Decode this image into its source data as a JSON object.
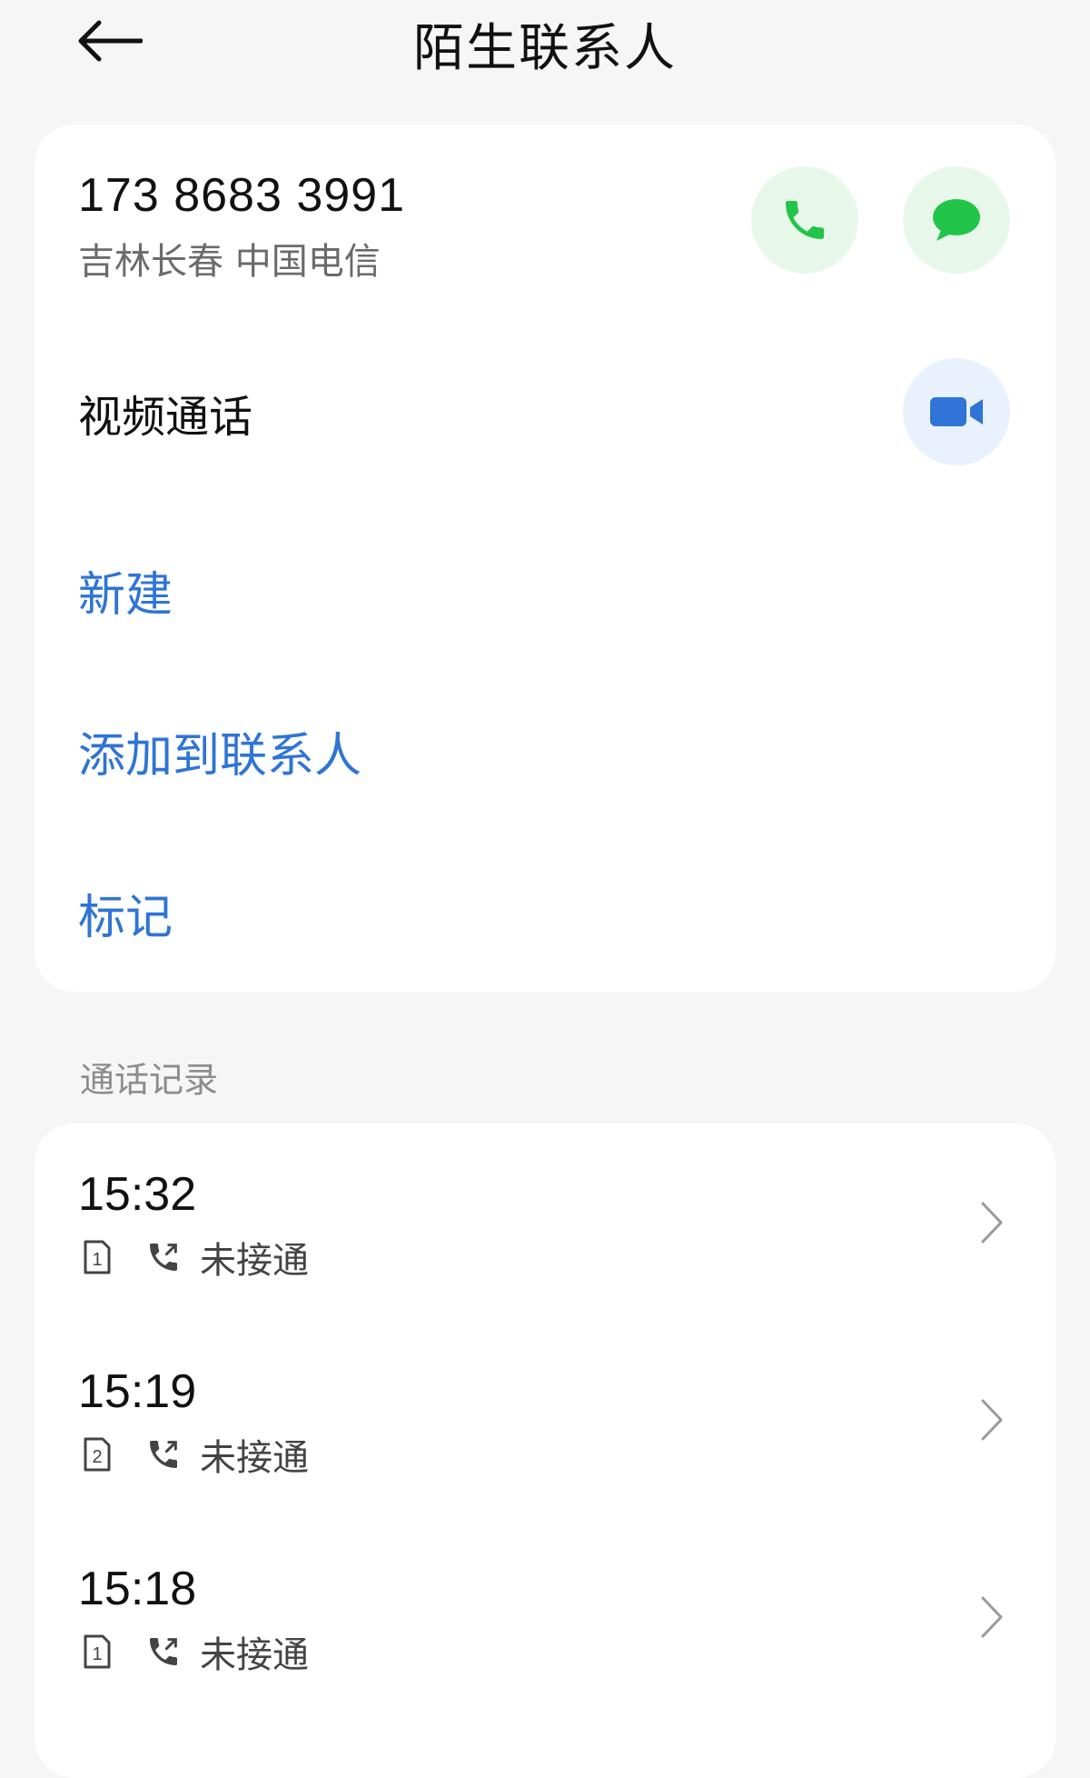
{
  "header": {
    "title": "陌生联系人"
  },
  "contact": {
    "number": "173 8683 3991",
    "location": "吉林长春 中国电信",
    "video_call_label": "视频通话"
  },
  "actions": {
    "new": "新建",
    "add_to_contacts": "添加到联系人",
    "mark": "标记"
  },
  "colors": {
    "accent": "#2f74d6",
    "green": "#23c44a",
    "video": "#2f74d6"
  },
  "call_log": {
    "title": "通话记录",
    "items": [
      {
        "time": "15:32",
        "sim": "1",
        "status": "未接通"
      },
      {
        "time": "15:19",
        "sim": "2",
        "status": "未接通"
      },
      {
        "time": "15:18",
        "sim": "1",
        "status": "未接通"
      }
    ]
  }
}
